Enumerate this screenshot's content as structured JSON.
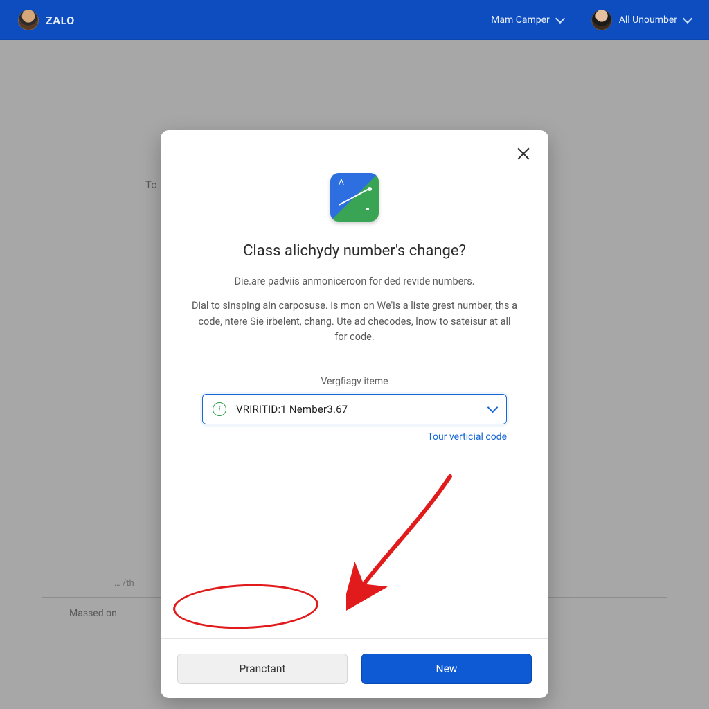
{
  "header": {
    "brand": "ZALO",
    "menu1": "Mam Camper",
    "menu2": "All Unoumber"
  },
  "background": {
    "stub1": "Tc",
    "stub2": "… /th",
    "stub3": "Massed on"
  },
  "modal": {
    "title": "Class alichydy number's change?",
    "subtitle": "Die.are padviis anmoniceroon for ded revide numbers.",
    "paragraph": "Dial to sinsping ain carposuse. is mon on We'is a liste grest number, ths a code, ntere Sie irbelent, chang. Ute ad checodes, lnow to sateisur at all for code.",
    "field_label": "Vergfiagv iteme",
    "select_value": "VRIRITID:1 Nember3.67",
    "helper_link": "Tour verticial code",
    "secondary_btn": "Pranctant",
    "primary_btn": "New"
  }
}
